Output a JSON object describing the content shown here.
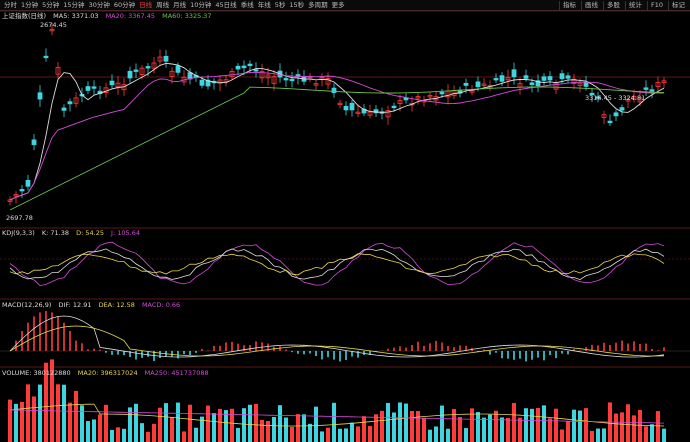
{
  "toolbar": {
    "periods": [
      "分时",
      "1分钟",
      "5分钟",
      "15分钟",
      "30分钟",
      "60分钟",
      "日线",
      "周线",
      "月线",
      "10分钟",
      "45日线",
      "季线",
      "年线",
      "5秒",
      "15秒",
      "多周期",
      "更多"
    ],
    "active_period": "日线",
    "right_tools": [
      "指标",
      "画线",
      "多股",
      "统计",
      "F10",
      "标记"
    ]
  },
  "main_panel": {
    "name": "上证指数(日线)",
    "ma_labels": [
      {
        "text": "MA5: 3371.03",
        "color": "#dddddd"
      },
      {
        "text": "MA20: 3367.45",
        "color": "#d24dd8"
      },
      {
        "text": "MA60: 3325.37",
        "color": "#6cc24a"
      }
    ],
    "high_label": "2674.45",
    "low_label": "2697.78",
    "range_label": "3316.45 - 3324.81"
  },
  "kdj_panel": {
    "labels": [
      {
        "text": "KDJ(9,3,3)",
        "color": "#dddddd"
      },
      {
        "text": "K: 71.38",
        "color": "#dddddd"
      },
      {
        "text": "D: 54.25",
        "color": "#e6d84a"
      },
      {
        "text": "J: 105.64",
        "color": "#d24dd8"
      }
    ]
  },
  "macd_panel": {
    "labels": [
      {
        "text": "MACD(12,26,9)",
        "color": "#dddddd"
      },
      {
        "text": "DIF: 12.91",
        "color": "#dddddd"
      },
      {
        "text": "DEA: 12.58",
        "color": "#e6d84a"
      },
      {
        "text": "MACD: 0.66",
        "color": "#d24dd8"
      }
    ]
  },
  "volume_panel": {
    "labels": [
      {
        "text": "VOLUME: 380122880",
        "color": "#dddddd"
      },
      {
        "text": "MA20: 396317024",
        "color": "#e6d84a"
      },
      {
        "text": "MA250: 451737088",
        "color": "#d24dd8"
      }
    ]
  },
  "colors": {
    "up": "#ff3b3b",
    "down": "#3fd5e0",
    "ma5": "#dddddd",
    "ma20": "#d24dd8",
    "ma60": "#6cc24a",
    "grid": "#7a1f1f"
  }
}
